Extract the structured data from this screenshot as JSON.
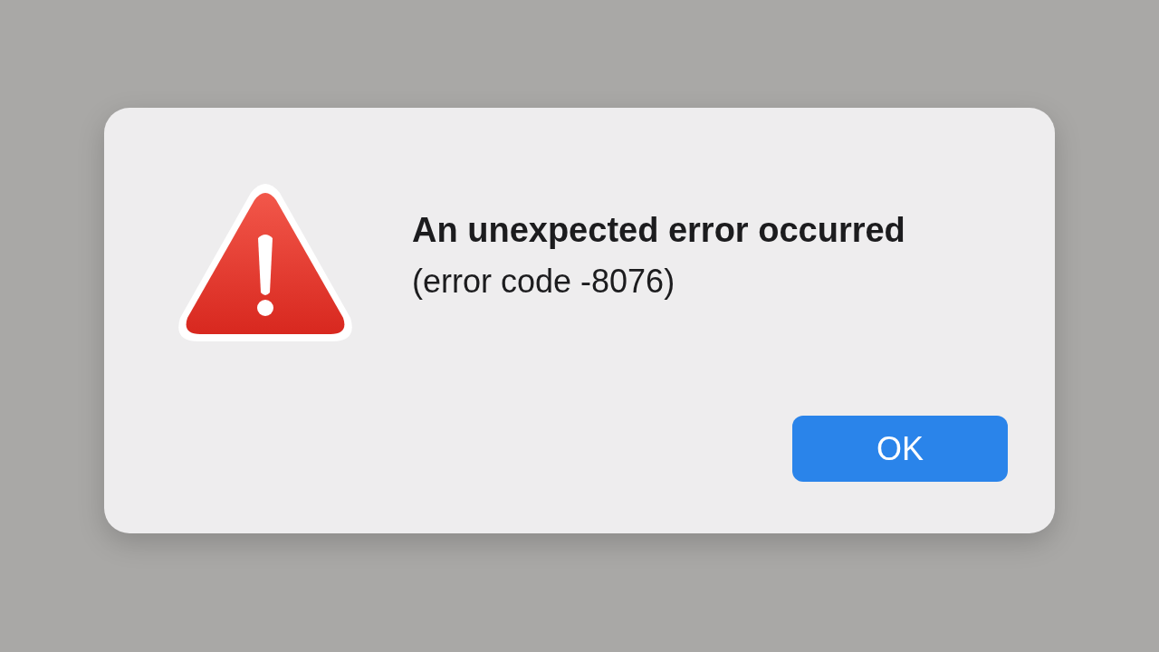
{
  "dialog": {
    "title": "An unexpected error occurred",
    "message": "(error code -8076)",
    "buttons": [
      {
        "label": "OK",
        "default": true
      }
    ]
  }
}
